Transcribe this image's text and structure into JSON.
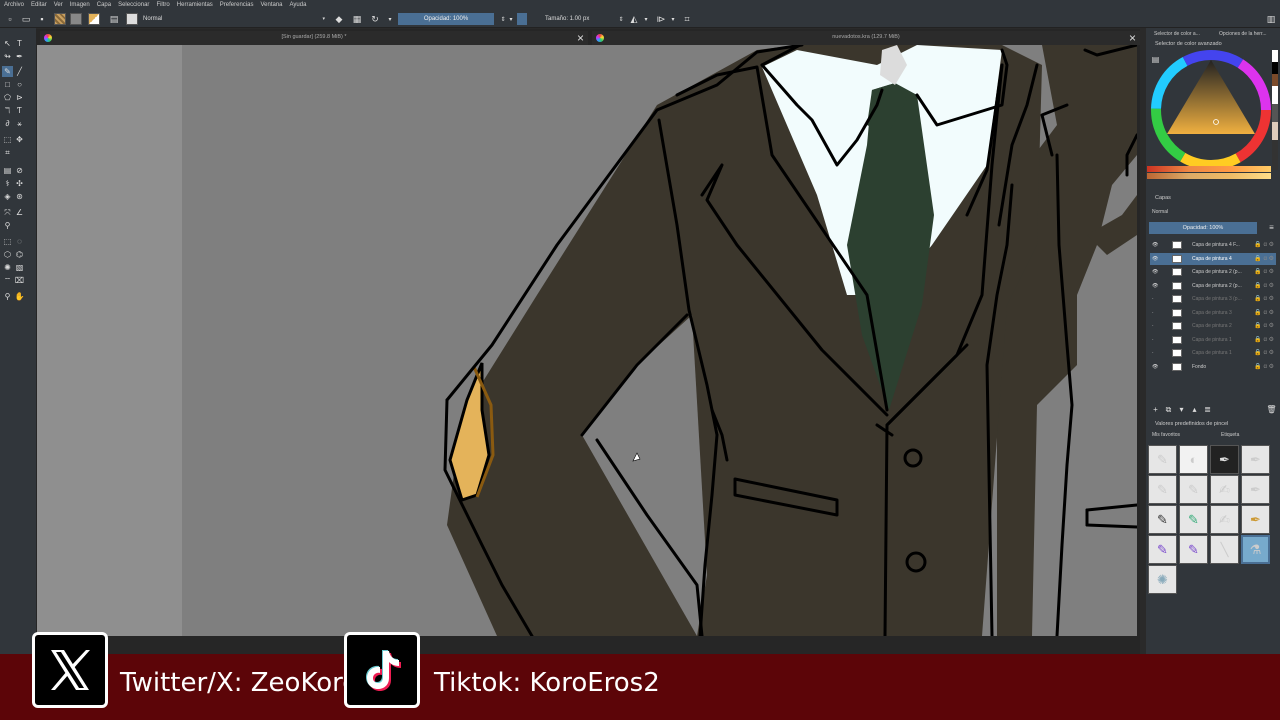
{
  "menu": [
    "Archivo",
    "Editar",
    "Ver",
    "Imagen",
    "Capa",
    "Seleccionar",
    "Filtro",
    "Herramientas",
    "Preferencias",
    "Ventana",
    "Ayuda"
  ],
  "toolbar": {
    "blend_mode": "Normal",
    "opacity_label": "Opacidad: 100%",
    "size_label": "Tamaño: 1.00 px"
  },
  "tabs": [
    {
      "title": "[Sin guardar]  (259.8 MiB) *"
    },
    {
      "title": "nuevadotos.kra  (129.7 MiB)"
    }
  ],
  "panels": {
    "top_tabs": [
      "Selector de color a...",
      "Opciones de la herr..."
    ],
    "color_selector_title": "Selector de color avanzado",
    "layers_title": "Capas",
    "layers_blend": "Normal",
    "layers_opacity": "Opacidad:  100%",
    "brush_presets_title": "Valores predefinidos de pincel",
    "brush_filter": "Mis favoritos",
    "brush_tag": "Etiqueta"
  },
  "layers": [
    {
      "name": "Capa de pintura 4 F...",
      "visible": true,
      "active": false
    },
    {
      "name": "Capa de pintura 4",
      "visible": true,
      "active": true
    },
    {
      "name": "Capa de pintura 2 (p...",
      "visible": true,
      "active": false
    },
    {
      "name": "Capa de pintura 2 (p...",
      "visible": true,
      "active": false
    },
    {
      "name": "Capa de pintura 3 (p...",
      "visible": false,
      "active": false
    },
    {
      "name": "Capa de pintura 3",
      "visible": false,
      "active": false
    },
    {
      "name": "Capa de pintura 2",
      "visible": false,
      "active": false
    },
    {
      "name": "Capa de pintura 1",
      "visible": false,
      "active": false
    },
    {
      "name": "Capa de pintura 1",
      "visible": false,
      "active": false
    },
    {
      "name": "Fondo",
      "visible": true,
      "active": false
    }
  ],
  "banner": {
    "twitter": "Twitter/X: ZeoKoro",
    "tiktok": "Tiktok: KoroEros2"
  },
  "colors": {
    "suit": "#3b362c",
    "shirt": "#f2fcfd",
    "tie": "#2c4030",
    "patch": "#e4b35a",
    "canvas_bg": "#7f7f7f",
    "banner": "#5c0508",
    "accent": "#4a6f94"
  }
}
